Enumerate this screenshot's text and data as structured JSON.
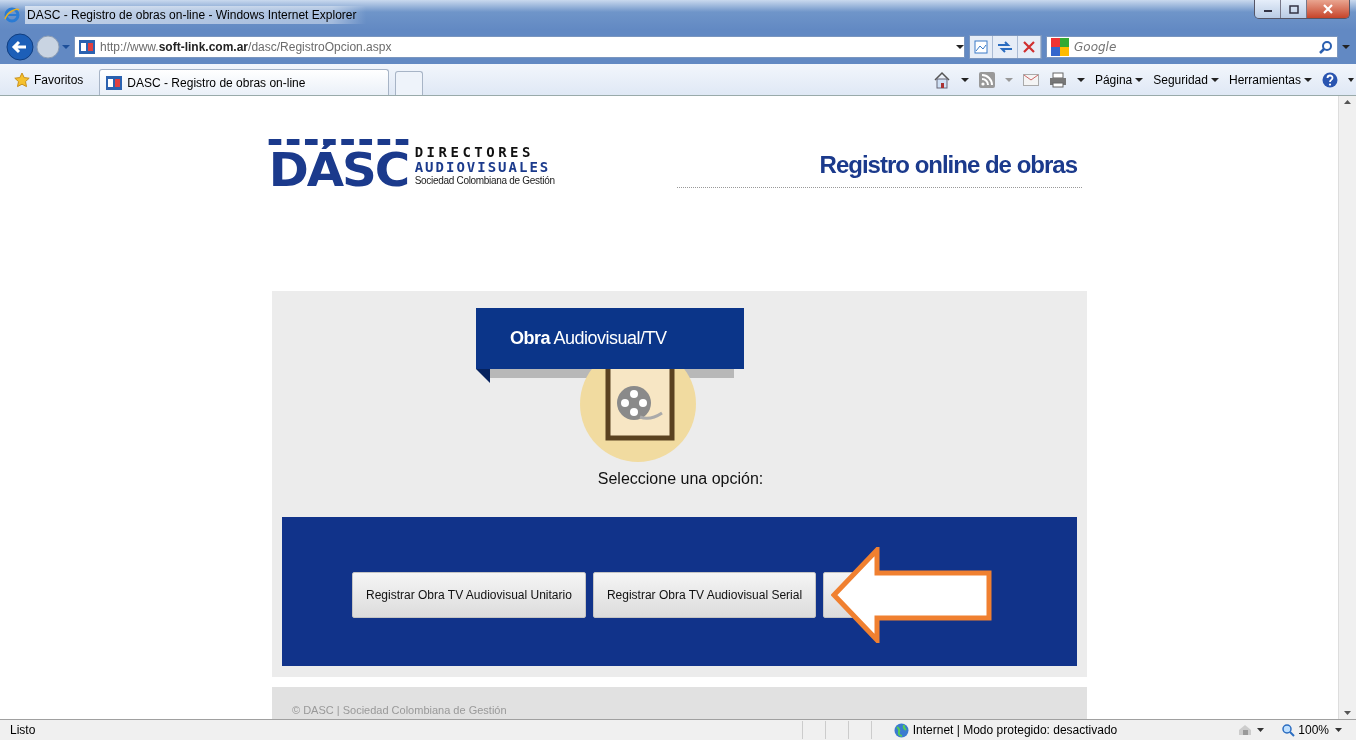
{
  "window": {
    "title": "DASC - Registro de obras on-line - Windows Internet Explorer"
  },
  "address_bar": {
    "url": "http://www.**soft-link.com.ar**/dasc/RegistroOpcion.aspx"
  },
  "search": {
    "placeholder": "Google"
  },
  "favorites_bar": {
    "favorites_label": "Favoritos",
    "tab_title": "DASC - Registro de obras on-line"
  },
  "command_bar": {
    "menus": [
      "Página",
      "Seguridad",
      "Herramientas"
    ]
  },
  "page": {
    "logo": {
      "mark": "DÁSC",
      "line_1": "DIRECTORES",
      "line_2": "AUDIOVISUALES",
      "line_3": "Sociedad Colombiana de Gestión"
    },
    "header_title": "Registro online de obras",
    "ribbon": "**Obra** Audiovisual/TV",
    "prompt": "Seleccione una opción:",
    "buttons": [
      {
        "kind": "labeled",
        "label": "Registrar Obra TV Audiovisual Unitario"
      },
      {
        "kind": "labeled",
        "label": "Registrar Obra TV Audiovisual Serial"
      },
      {
        "kind": "covered"
      }
    ],
    "footer": "© DASC | Sociedad Colombiana de Gestión"
  },
  "status_bar": {
    "status": "Listo",
    "zone": "Internet | Modo protegido: desactivado",
    "zoom": "100%"
  }
}
